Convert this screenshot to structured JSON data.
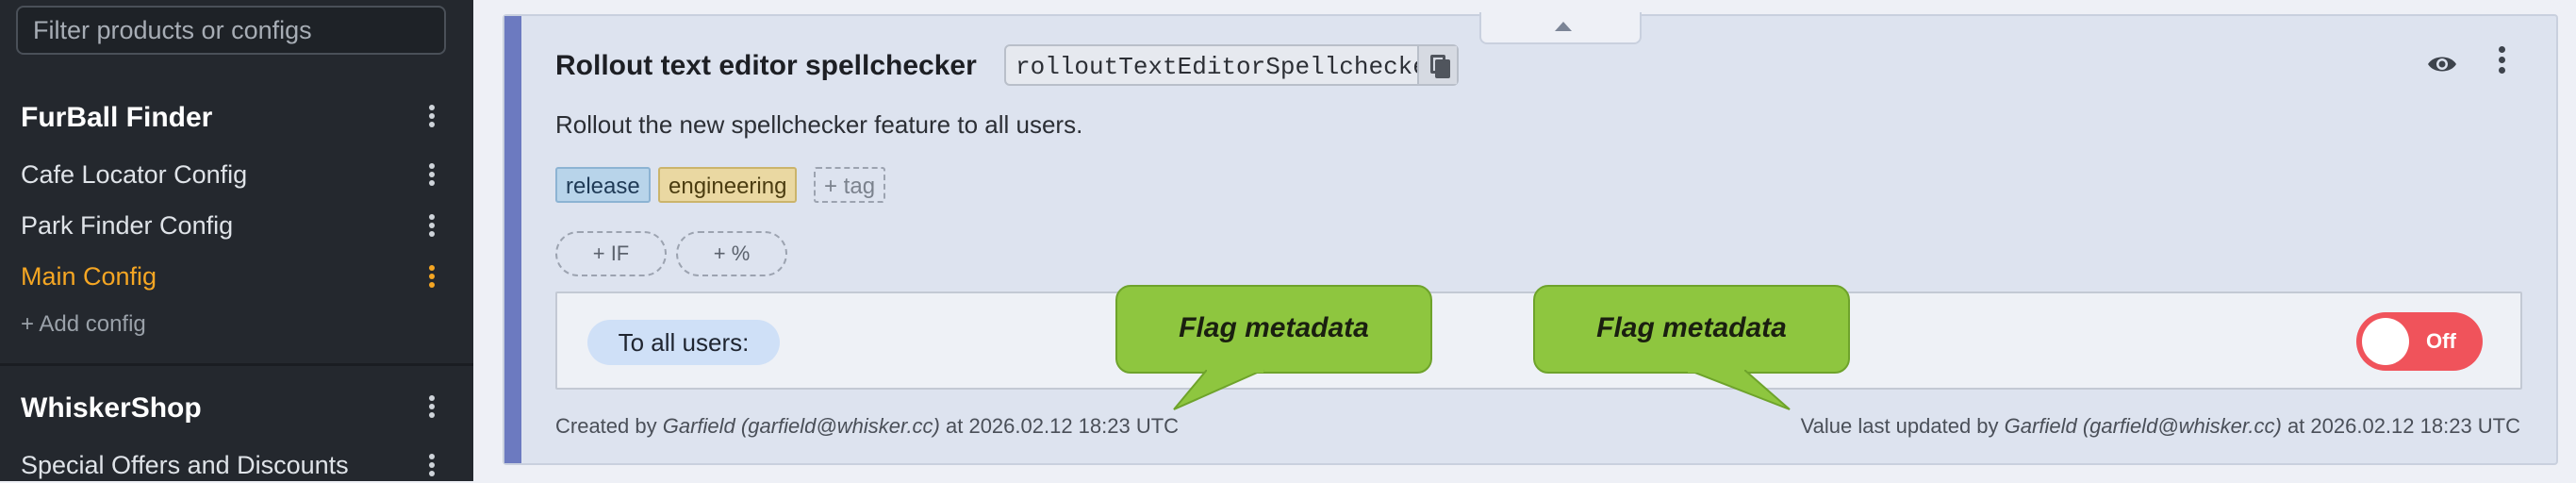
{
  "sidebar": {
    "filter_placeholder": "Filter products or configs",
    "products": [
      {
        "name": "FurBall Finder",
        "configs": [
          "Cafe Locator Config",
          "Park Finder Config",
          "Main Config"
        ],
        "active_config": "Main Config",
        "add_config_label": "+ Add config"
      },
      {
        "name": "WhiskerShop",
        "configs": [
          "Special Offers and Discounts"
        ]
      }
    ]
  },
  "flag": {
    "title": "Rollout text editor spellchecker",
    "key": "rolloutTextEditorSpellchecker",
    "description": "Rollout the new spellchecker feature to all users.",
    "tags": [
      "release",
      "engineering"
    ],
    "add_tag_label": "+ tag",
    "add_if_label": "+ IF",
    "add_percent_label": "+ %",
    "rule_label": "To all users:",
    "toggle": {
      "state": "Off",
      "on": false
    },
    "created_prefix": "Created by ",
    "created_by": "Garfield (garfield@whisker.cc)",
    "created_suffix": " at 2026.02.12 18:23 UTC",
    "updated_prefix": "Value last updated by ",
    "updated_by": "Garfield (garfield@whisker.cc)",
    "updated_suffix": " at 2026.02.12 18:23 UTC"
  },
  "callouts": [
    "Flag metadata",
    "Flag metadata"
  ],
  "colors": {
    "sidebar_bg": "#24282e",
    "active": "#f5a623",
    "toggle_off": "#f0535b",
    "callout": "#8ec63f",
    "tag_release": "#b8d4ea",
    "tag_engineering": "#ead8a2"
  },
  "icons": [
    "copy-icon",
    "eye-icon",
    "kebab-menu-icon",
    "chevron-up-icon"
  ]
}
